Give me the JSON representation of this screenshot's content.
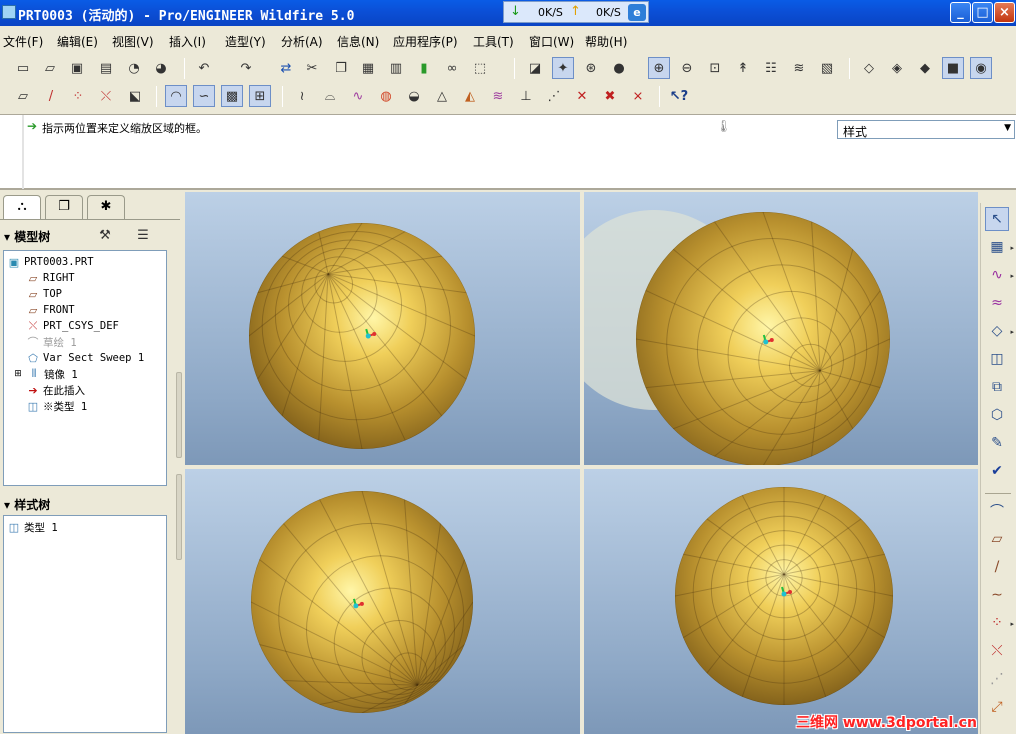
{
  "title": {
    "text": "PRT0003 (活动的) - Pro/ENGINEER Wildfire 5.0"
  },
  "net_monitor": {
    "down": "0K/S",
    "up": "0K/S"
  },
  "window_controls": {
    "minimize": "_",
    "maximize": "□",
    "close": "×"
  },
  "menu": [
    "文件(F)",
    "编辑(E)",
    "视图(V)",
    "插入(I)",
    "造型(Y)",
    "分析(A)",
    "信息(N)",
    "应用程序(P)",
    "工具(T)",
    "窗口(W)",
    "帮助(H)"
  ],
  "toolbar1_icons": [
    "new-icon",
    "open-icon",
    "save-icon",
    "print-icon",
    "send-icon",
    "copy-email-icon",
    "undo-icon",
    "redo-icon",
    "regenerate-icon",
    "cut-icon",
    "copy-icon",
    "paste-icon",
    "paste-special-icon",
    "traffic-light-icon",
    "binoculars-icon",
    "selection-box-icon",
    "datum-display-icon",
    "spin-center-icon",
    "orient-icon",
    "appearance-icon",
    "zoom-in-icon",
    "zoom-out-icon",
    "refit-icon",
    "repaint-icon",
    "view-manager-icon",
    "layers-icon",
    "saved-view-icon",
    "wireframe-icon",
    "hidden-line-icon",
    "no-hidden-icon",
    "shading-icon",
    "enhanced-realism-icon"
  ],
  "toolbar2_icons": [
    "plane-display-icon",
    "axis-display-icon",
    "point-display-icon",
    "csys-display-icon",
    "annotation-icon",
    "curve-display-icon",
    "surface-display-icon",
    "grid-icon",
    "snap-icon",
    "curvature-icon",
    "section-icon",
    "offset-icon",
    "reflection-icon",
    "draft-icon",
    "slope-icon",
    "shade-analysis-icon",
    "isophote-icon",
    "dihedral-icon",
    "deviation-icon",
    "delete-analysis-icon",
    "delete-all-icon",
    "delete-curves-icon",
    "whats-this-icon"
  ],
  "message": {
    "text": "指示两位置来定义缩放区域的框。"
  },
  "filter": {
    "value": "样式"
  },
  "left_tabs": [
    "model-tree-tab",
    "folder-browser-tab",
    "favorites-tab"
  ],
  "model_tree": {
    "title": "模型树",
    "items": [
      {
        "label": "PRT0003.PRT",
        "icon": "part-icon"
      },
      {
        "label": "RIGHT",
        "icon": "datum-plane-icon"
      },
      {
        "label": "TOP",
        "icon": "datum-plane-icon"
      },
      {
        "label": "FRONT",
        "icon": "datum-plane-icon"
      },
      {
        "label": "PRT_CSYS_DEF",
        "icon": "csys-icon"
      },
      {
        "label": "草绘 1",
        "icon": "sketch-icon"
      },
      {
        "label": "Var Sect Sweep 1",
        "icon": "sweep-icon"
      },
      {
        "label": "镜像 1",
        "icon": "mirror-icon"
      },
      {
        "label": "在此插入",
        "icon": "insert-arrow-icon"
      },
      {
        "label": "※类型 1",
        "icon": "style-feature-icon"
      }
    ]
  },
  "style_tree": {
    "title": "样式树",
    "items": [
      {
        "label": "类型 1",
        "icon": "style-feature-icon"
      }
    ]
  },
  "right_toolbar_icons": [
    "select-icon",
    "set-active-plane-icon",
    "create-curve-icon",
    "curve-edit-icon",
    "boundary-surface-icon",
    "connect-surface-icon",
    "trim-surface-icon",
    "surface-edit-icon",
    "curve-on-surface-icon",
    "done-icon",
    "curvature-analysis-icon",
    "plane-icon",
    "axis-icon",
    "sketched-curve-icon",
    "point-icon",
    "csys-icon",
    "analysis-icon",
    "offset-curve-icon"
  ],
  "watermark": "三维网 www.3dportal.cn",
  "colors": {
    "title_bar": "#0b4fd6",
    "sphere_dark": "#5a3e10",
    "sphere_mid": "#b28a30",
    "sphere_light": "#fff3a0",
    "viewport_bg_top": "#bcd0e6"
  }
}
